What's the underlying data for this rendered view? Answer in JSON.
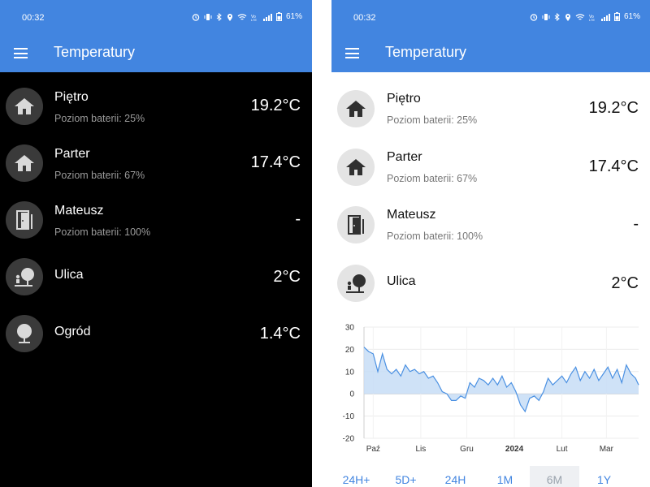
{
  "status": {
    "time": "00:32",
    "battery": "61%"
  },
  "app": {
    "title": "Temperatury"
  },
  "left_sensors": [
    {
      "name": "Piętro",
      "battery": "Poziom baterii: 25%",
      "temp": "19.2°C",
      "icon": "home-icon"
    },
    {
      "name": "Parter",
      "battery": "Poziom baterii: 67%",
      "temp": "17.4°C",
      "icon": "home-icon"
    },
    {
      "name": "Mateusz",
      "battery": "Poziom baterii: 100%",
      "temp": "-",
      "icon": "door-icon"
    },
    {
      "name": "Ulica",
      "battery": "",
      "temp": "2°C",
      "icon": "street-tree-icon"
    },
    {
      "name": "Ogród",
      "battery": "",
      "temp": "1.4°C",
      "icon": "tree-icon"
    }
  ],
  "right_sensors": [
    {
      "name": "Piętro",
      "battery": "Poziom baterii: 25%",
      "temp": "19.2°C",
      "icon": "home-icon"
    },
    {
      "name": "Parter",
      "battery": "Poziom baterii: 67%",
      "temp": "17.4°C",
      "icon": "home-icon"
    },
    {
      "name": "Mateusz",
      "battery": "Poziom baterii: 100%",
      "temp": "-",
      "icon": "door-icon"
    },
    {
      "name": "Ulica",
      "battery": "",
      "temp": "2°C",
      "icon": "street-tree-icon"
    }
  ],
  "chart_data": {
    "type": "area",
    "ylim": [
      -20,
      30
    ],
    "yticks": [
      "30",
      "20",
      "10",
      "0",
      "-10",
      "-20"
    ],
    "xticks": [
      "Paź",
      "Lis",
      "Gru",
      "2024",
      "Lut",
      "Mar"
    ],
    "x_start": "2023-09-25",
    "x_end": "2024-03-22",
    "series": [
      {
        "color": "#4a90e2",
        "fill": "#c7ddf6",
        "x": [
          "2023-09-25",
          "2023-09-28",
          "2023-10-01",
          "2023-10-04",
          "2023-10-07",
          "2023-10-10",
          "2023-10-13",
          "2023-10-16",
          "2023-10-19",
          "2023-10-22",
          "2023-10-25",
          "2023-10-28",
          "2023-10-31",
          "2023-11-03",
          "2023-11-06",
          "2023-11-09",
          "2023-11-12",
          "2023-11-15",
          "2023-11-18",
          "2023-11-21",
          "2023-11-24",
          "2023-11-27",
          "2023-11-30",
          "2023-12-03",
          "2023-12-06",
          "2023-12-09",
          "2023-12-12",
          "2023-12-15",
          "2023-12-18",
          "2023-12-21",
          "2023-12-24",
          "2023-12-27",
          "2023-12-30",
          "2024-01-02",
          "2024-01-05",
          "2024-01-08",
          "2024-01-11",
          "2024-01-14",
          "2024-01-17",
          "2024-01-20",
          "2024-01-23",
          "2024-01-26",
          "2024-01-29",
          "2024-02-01",
          "2024-02-04",
          "2024-02-07",
          "2024-02-10",
          "2024-02-13",
          "2024-02-16",
          "2024-02-19",
          "2024-02-22",
          "2024-02-25",
          "2024-02-28",
          "2024-03-02",
          "2024-03-05",
          "2024-03-08",
          "2024-03-11",
          "2024-03-14",
          "2024-03-17",
          "2024-03-20",
          "2024-03-22"
        ],
        "values": [
          21,
          19,
          18,
          10,
          18,
          11,
          9,
          11,
          8,
          13,
          10,
          11,
          9,
          10,
          7,
          8,
          5,
          1,
          0,
          -3,
          -3,
          -1,
          -2,
          5,
          3,
          7,
          6,
          4,
          7,
          4,
          8,
          3,
          5,
          1,
          -5,
          -8,
          -2,
          -1,
          -3,
          1,
          7,
          4,
          6,
          8,
          5,
          9,
          12,
          6,
          10,
          7,
          11,
          6,
          9,
          12,
          7,
          11,
          5,
          13,
          9,
          7,
          4
        ]
      }
    ]
  },
  "ranges": [
    {
      "label": "24H+",
      "selected": false
    },
    {
      "label": "5D+",
      "selected": false
    },
    {
      "label": "24H",
      "selected": false
    },
    {
      "label": "1M",
      "selected": false
    },
    {
      "label": "6M",
      "selected": true
    },
    {
      "label": "1Y",
      "selected": false
    }
  ]
}
